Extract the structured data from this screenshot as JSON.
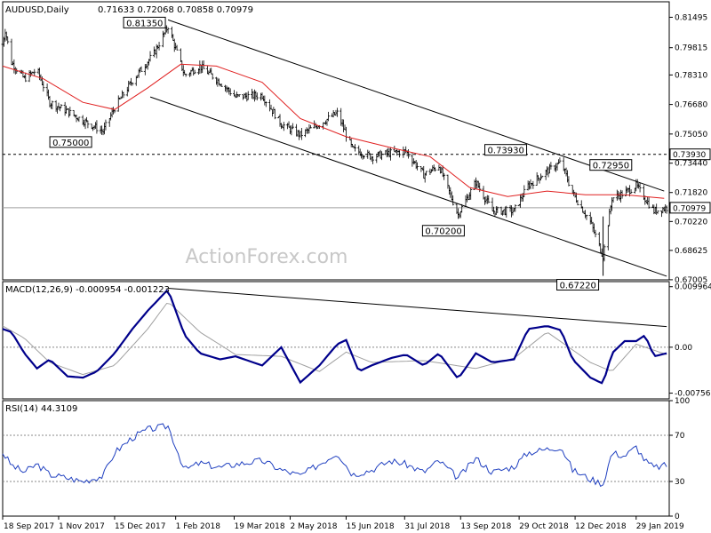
{
  "chart_data": [
    {
      "type": "ohlc",
      "panel": "price",
      "title": "AUDUSD,Daily",
      "ohlc_text": "0.71633 0.72068 0.70858 0.70979",
      "watermark": "ActionForex.com",
      "ylim": [
        0.67,
        0.8235
      ],
      "y_ticks": [
        "0.81495",
        "0.79815",
        "0.78310",
        "0.76680",
        "0.75050",
        "0.73440",
        "0.71820",
        "0.70220",
        "0.68625",
        "0.67005"
      ],
      "last_price": "0.70979",
      "horizontal_level": "0.73930",
      "price_levels": [
        {
          "label": "0.81350",
          "date": "2018-01-26",
          "price": 0.8135
        },
        {
          "label": "0.75000",
          "date": "2017-12-06",
          "price": 0.75
        },
        {
          "label": "0.73930",
          "date": "2018-10-30",
          "price": 0.7393
        },
        {
          "label": "0.72950",
          "date": "2019-01-29",
          "price": 0.7295
        },
        {
          "label": "0.70200",
          "date": "2018-09-11",
          "price": 0.702
        },
        {
          "label": "0.67220",
          "date": "2019-01-03",
          "price": 0.6722
        }
      ],
      "channel_upper": [
        [
          "2018-01-26",
          0.8135
        ],
        [
          "2019-02-20",
          0.719
        ]
      ],
      "channel_lower": [
        [
          "2018-01-26",
          0.7695
        ],
        [
          "2019-02-22",
          0.672
        ]
      ],
      "ma_series": [
        [
          "2017-09-18",
          0.788
        ],
        [
          "2017-10-20",
          0.781
        ],
        [
          "2017-11-20",
          0.768
        ],
        [
          "2017-12-15",
          0.764
        ],
        [
          "2018-01-10",
          0.776
        ],
        [
          "2018-02-05",
          0.789
        ],
        [
          "2018-03-05",
          0.788
        ],
        [
          "2018-04-10",
          0.779
        ],
        [
          "2018-05-10",
          0.759
        ],
        [
          "2018-06-15",
          0.749
        ],
        [
          "2018-07-20",
          0.743
        ],
        [
          "2018-08-20",
          0.738
        ],
        [
          "2018-09-20",
          0.721
        ],
        [
          "2018-10-20",
          0.716
        ],
        [
          "2018-11-20",
          0.719
        ],
        [
          "2018-12-20",
          0.717
        ],
        [
          "2019-01-20",
          0.717
        ],
        [
          "2019-02-20",
          0.715
        ]
      ],
      "close_series": [
        [
          "2017-09-18",
          0.8
        ],
        [
          "2017-09-20",
          0.808
        ],
        [
          "2017-09-25",
          0.79
        ],
        [
          "2017-10-05",
          0.781
        ],
        [
          "2017-10-15",
          0.786
        ],
        [
          "2017-10-25",
          0.768
        ],
        [
          "2017-11-08",
          0.763
        ],
        [
          "2017-11-20",
          0.758
        ],
        [
          "2017-12-06",
          0.752
        ],
        [
          "2017-12-15",
          0.765
        ],
        [
          "2017-12-29",
          0.78
        ],
        [
          "2018-01-15",
          0.795
        ],
        [
          "2018-01-26",
          0.81
        ],
        [
          "2018-02-08",
          0.783
        ],
        [
          "2018-02-20",
          0.788
        ],
        [
          "2018-03-08",
          0.779
        ],
        [
          "2018-03-20",
          0.771
        ],
        [
          "2018-04-10",
          0.772
        ],
        [
          "2018-04-25",
          0.756
        ],
        [
          "2018-05-10",
          0.75
        ],
        [
          "2018-05-25",
          0.756
        ],
        [
          "2018-06-08",
          0.762
        ],
        [
          "2018-06-20",
          0.742
        ],
        [
          "2018-07-05",
          0.738
        ],
        [
          "2018-07-20",
          0.74
        ],
        [
          "2018-08-01",
          0.741
        ],
        [
          "2018-08-15",
          0.728
        ],
        [
          "2018-08-27",
          0.733
        ],
        [
          "2018-09-11",
          0.706
        ],
        [
          "2018-09-25",
          0.724
        ],
        [
          "2018-10-08",
          0.708
        ],
        [
          "2018-10-25",
          0.708
        ],
        [
          "2018-11-05",
          0.722
        ],
        [
          "2018-11-20",
          0.73
        ],
        [
          "2018-12-01",
          0.735
        ],
        [
          "2018-12-10",
          0.718
        ],
        [
          "2018-12-24",
          0.702
        ],
        [
          "2019-01-03",
          0.683
        ],
        [
          "2019-01-10",
          0.715
        ],
        [
          "2019-01-20",
          0.718
        ],
        [
          "2019-01-29",
          0.722
        ],
        [
          "2019-02-05",
          0.715
        ],
        [
          "2019-02-12",
          0.708
        ],
        [
          "2019-02-22",
          0.7098
        ]
      ]
    },
    {
      "type": "line",
      "panel": "macd",
      "title": "MACD(12,26,9) -0.000954 -0.001223",
      "ylim": [
        -0.0085,
        0.0108
      ],
      "y_ticks": [
        "0.009964",
        "0.00",
        "-0.00756"
      ],
      "trendline": [
        [
          "2018-01-26",
          0.0097
        ],
        [
          "2019-02-22",
          0.0034
        ]
      ],
      "series": [
        {
          "values": [
            [
              "2017-09-18",
              0.003
            ],
            [
              "2017-09-25",
              0.0025
            ],
            [
              "2017-10-05",
              -0.001
            ],
            [
              "2017-10-15",
              -0.0035
            ],
            [
              "2017-10-25",
              -0.002
            ],
            [
              "2017-11-08",
              -0.0048
            ],
            [
              "2017-11-20",
              -0.005
            ],
            [
              "2017-12-01",
              -0.004
            ],
            [
              "2017-12-15",
              -0.001
            ],
            [
              "2017-12-29",
              0.003
            ],
            [
              "2018-01-10",
              0.006
            ],
            [
              "2018-01-26",
              0.0095
            ],
            [
              "2018-02-08",
              0.002
            ],
            [
              "2018-02-20",
              -0.001
            ],
            [
              "2018-03-08",
              -0.002
            ],
            [
              "2018-03-20",
              -0.0015
            ],
            [
              "2018-04-10",
              -0.003
            ],
            [
              "2018-04-20",
              -0.001
            ],
            [
              "2018-04-25",
              0.0
            ],
            [
              "2018-05-10",
              -0.0058
            ],
            [
              "2018-05-25",
              -0.003
            ],
            [
              "2018-06-08",
              0.0005
            ],
            [
              "2018-06-15",
              0.0012
            ],
            [
              "2018-06-25",
              -0.004
            ],
            [
              "2018-07-05",
              -0.003
            ],
            [
              "2018-07-20",
              -0.0018
            ],
            [
              "2018-08-01",
              -0.0012
            ],
            [
              "2018-08-15",
              -0.003
            ],
            [
              "2018-08-27",
              -0.001
            ],
            [
              "2018-09-11",
              -0.0052
            ],
            [
              "2018-09-25",
              -0.001
            ],
            [
              "2018-10-08",
              -0.0025
            ],
            [
              "2018-10-25",
              -0.002
            ],
            [
              "2018-11-05",
              0.003
            ],
            [
              "2018-11-20",
              0.0035
            ],
            [
              "2018-12-01",
              0.0028
            ],
            [
              "2018-12-10",
              -0.002
            ],
            [
              "2018-12-24",
              -0.005
            ],
            [
              "2019-01-03",
              -0.006
            ],
            [
              "2019-01-10",
              -0.001
            ],
            [
              "2019-01-20",
              0.001
            ],
            [
              "2019-01-29",
              0.001
            ],
            [
              "2019-02-05",
              0.002
            ],
            [
              "2019-02-12",
              -0.0015
            ],
            [
              "2019-02-22",
              -0.001
            ]
          ]
        },
        {
          "values": [
            [
              "2017-09-18",
              0.0035
            ],
            [
              "2017-10-05",
              0.0015
            ],
            [
              "2017-10-25",
              -0.0025
            ],
            [
              "2017-11-20",
              -0.0045
            ],
            [
              "2017-12-15",
              -0.003
            ],
            [
              "2018-01-10",
              0.003
            ],
            [
              "2018-01-26",
              0.0075
            ],
            [
              "2018-02-20",
              0.0025
            ],
            [
              "2018-03-20",
              -0.0012
            ],
            [
              "2018-04-25",
              -0.0015
            ],
            [
              "2018-05-25",
              -0.004
            ],
            [
              "2018-06-15",
              -0.0008
            ],
            [
              "2018-07-05",
              -0.0025
            ],
            [
              "2018-08-15",
              -0.0022
            ],
            [
              "2018-09-25",
              -0.0035
            ],
            [
              "2018-10-25",
              -0.0018
            ],
            [
              "2018-11-20",
              0.0025
            ],
            [
              "2018-12-24",
              -0.0025
            ],
            [
              "2019-01-10",
              -0.004
            ],
            [
              "2019-01-29",
              0.0005
            ],
            [
              "2019-02-22",
              -0.0012
            ]
          ]
        }
      ]
    },
    {
      "type": "line",
      "panel": "rsi",
      "title": "RSI(14) 44.3109",
      "ylim": [
        0,
        100
      ],
      "y_ticks": [
        "100",
        "70",
        "30",
        "0"
      ],
      "levels": [
        70,
        30
      ],
      "series": [
        {
          "values": [
            [
              "2017-09-18",
              55
            ],
            [
              "2017-09-25",
              44
            ],
            [
              "2017-10-05",
              38
            ],
            [
              "2017-10-15",
              45
            ],
            [
              "2017-10-25",
              36
            ],
            [
              "2017-11-08",
              33
            ],
            [
              "2017-11-20",
              30
            ],
            [
              "2017-12-06",
              35
            ],
            [
              "2017-12-15",
              55
            ],
            [
              "2017-12-29",
              68
            ],
            [
              "2018-01-10",
              75
            ],
            [
              "2018-01-26",
              78
            ],
            [
              "2018-02-08",
              40
            ],
            [
              "2018-02-20",
              46
            ],
            [
              "2018-03-08",
              42
            ],
            [
              "2018-03-20",
              45
            ],
            [
              "2018-04-10",
              48
            ],
            [
              "2018-04-25",
              40
            ],
            [
              "2018-05-10",
              35
            ],
            [
              "2018-05-25",
              45
            ],
            [
              "2018-06-08",
              55
            ],
            [
              "2018-06-20",
              36
            ],
            [
              "2018-07-05",
              40
            ],
            [
              "2018-07-20",
              48
            ],
            [
              "2018-08-01",
              45
            ],
            [
              "2018-08-15",
              38
            ],
            [
              "2018-08-27",
              48
            ],
            [
              "2018-09-11",
              33
            ],
            [
              "2018-09-25",
              50
            ],
            [
              "2018-10-08",
              38
            ],
            [
              "2018-10-25",
              43
            ],
            [
              "2018-11-05",
              55
            ],
            [
              "2018-11-20",
              58
            ],
            [
              "2018-12-01",
              60
            ],
            [
              "2018-12-10",
              40
            ],
            [
              "2018-12-24",
              32
            ],
            [
              "2019-01-03",
              28
            ],
            [
              "2019-01-10",
              55
            ],
            [
              "2019-01-20",
              52
            ],
            [
              "2019-01-29",
              60
            ],
            [
              "2019-02-05",
              48
            ],
            [
              "2019-02-12",
              42
            ],
            [
              "2019-02-22",
              44
            ]
          ]
        }
      ]
    }
  ],
  "x_axis_labels": [
    {
      "date": "2017-09-18",
      "label": "18 Sep 2017"
    },
    {
      "date": "2017-11-01",
      "label": "1 Nov 2017"
    },
    {
      "date": "2017-12-15",
      "label": "15 Dec 2017"
    },
    {
      "date": "2018-02-01",
      "label": "1 Feb 2018"
    },
    {
      "date": "2018-03-19",
      "label": "19 Mar 2018"
    },
    {
      "date": "2018-05-02",
      "label": "2 May 2018"
    },
    {
      "date": "2018-06-15",
      "label": "15 Jun 2018"
    },
    {
      "date": "2018-07-31",
      "label": "31 Jul 2018"
    },
    {
      "date": "2018-09-13",
      "label": "13 Sep 2018"
    },
    {
      "date": "2018-10-29",
      "label": "29 Oct 2018"
    },
    {
      "date": "2018-12-12",
      "label": "12 Dec 2018"
    },
    {
      "date": "2019-01-29",
      "label": "29 Jan 2019"
    }
  ],
  "colors": {
    "price_bars": "#000000",
    "moving_average": "#e02020",
    "channel_lines": "#000000",
    "macd_line": "#00008b",
    "macd_signal": "#a0a0a0",
    "rsi_line": "#2040c0",
    "level_lines": "#a0a0a0",
    "watermark": "#c8c8c8"
  }
}
